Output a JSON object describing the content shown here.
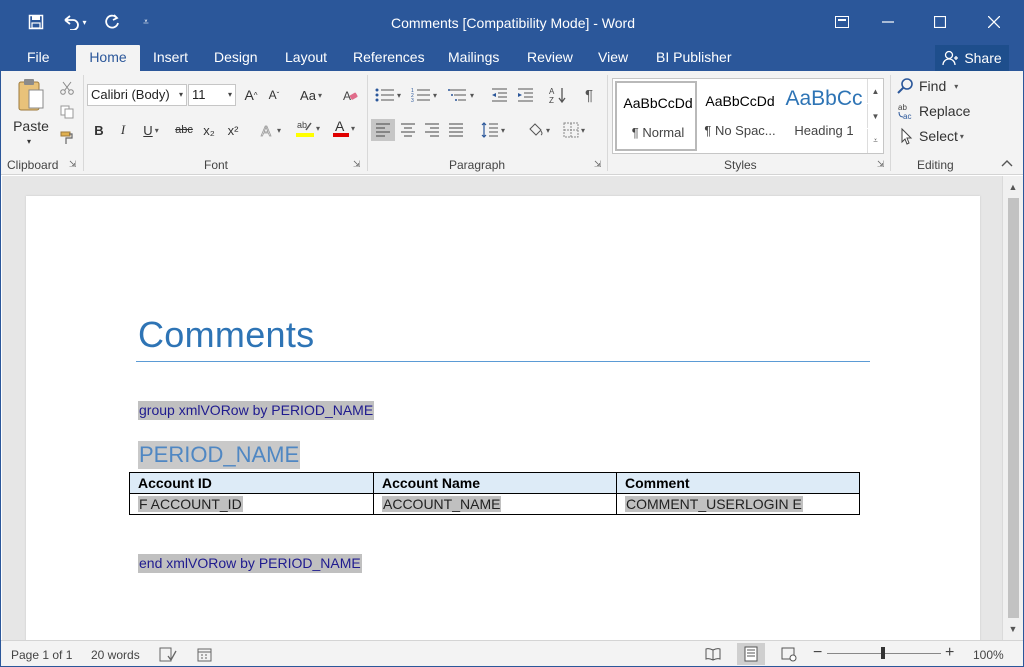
{
  "window": {
    "title": "Comments [Compatibility Mode] - Word",
    "minimize_icon": "minimize-icon",
    "maximize_icon": "maximize-icon",
    "close_icon": "close-icon"
  },
  "tabs": [
    {
      "label": "File"
    },
    {
      "label": "Home"
    },
    {
      "label": "Insert"
    },
    {
      "label": "Design"
    },
    {
      "label": "Layout"
    },
    {
      "label": "References"
    },
    {
      "label": "Mailings"
    },
    {
      "label": "Review"
    },
    {
      "label": "View"
    },
    {
      "label": "BI Publisher"
    }
  ],
  "share": {
    "label": "Share"
  },
  "ribbon": {
    "clipboard": {
      "label": "Clipboard",
      "paste_label": "Paste"
    },
    "font": {
      "label": "Font",
      "font_name": "Calibri (Body)",
      "font_size": "11",
      "change_case": "Aa",
      "bold": "B",
      "italic": "I",
      "underline": "U",
      "strike": "abc",
      "subscript": "x₂",
      "superscript": "x²",
      "grow": "A",
      "shrink": "A"
    },
    "paragraph": {
      "label": "Paragraph"
    },
    "styles": {
      "label": "Styles",
      "items": [
        {
          "preview": "AaBbCcDd",
          "name": "¶ Normal"
        },
        {
          "preview": "AaBbCcDd",
          "name": "¶ No Spac..."
        },
        {
          "preview": "AaBbCc",
          "name": "Heading 1"
        }
      ]
    },
    "editing": {
      "label": "Editing",
      "find": "Find",
      "replace": "Replace",
      "select": "Select"
    }
  },
  "document": {
    "title": "Comments",
    "group_start": "group xmlVORow by PERIOD_NAME",
    "period_field": "PERIOD_NAME",
    "table": {
      "headers": [
        "Account ID",
        "Account Name",
        "Comment"
      ],
      "row": [
        "F ACCOUNT_ID",
        "ACCOUNT_NAME",
        "COMMENT_USERLOGIN E"
      ]
    },
    "group_end": "end xmlVORow by PERIOD_NAME"
  },
  "status": {
    "page": "Page 1 of 1",
    "words": "20 words",
    "zoom": "100%",
    "zoom_minus": "−",
    "zoom_plus": "+"
  },
  "colors": {
    "accent": "#2b579a",
    "title_text": "#2e74b5",
    "field_shading": "#c0c0c0",
    "header_fill": "#ddebf7"
  }
}
